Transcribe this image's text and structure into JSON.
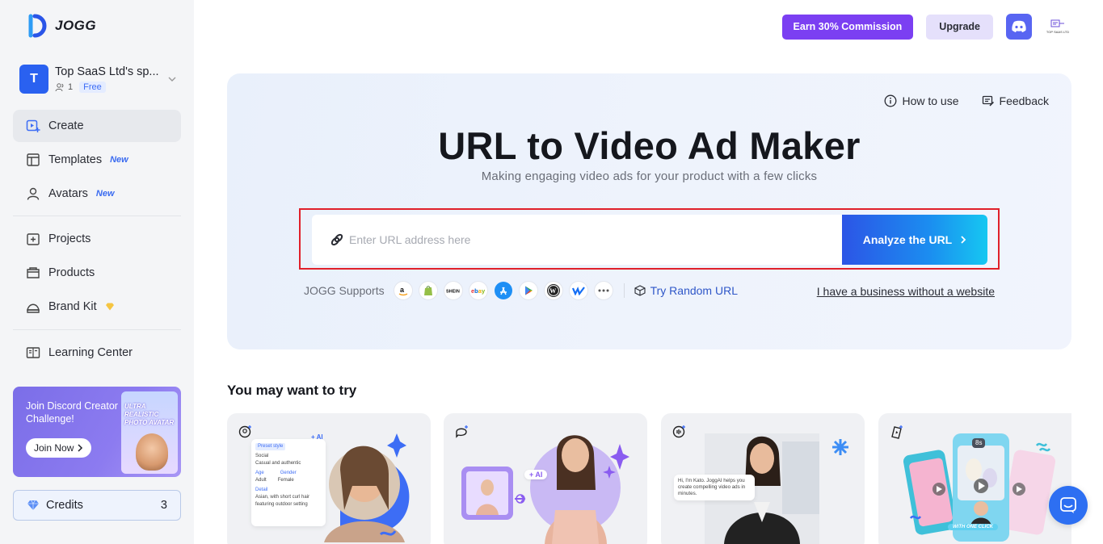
{
  "brand": {
    "name": "JOGG"
  },
  "workspace": {
    "initial": "T",
    "name": "Top SaaS Ltd's sp...",
    "members": "1",
    "plan": "Free"
  },
  "nav": {
    "create": "Create",
    "templates": "Templates",
    "templates_badge": "New",
    "avatars": "Avatars",
    "avatars_badge": "New",
    "projects": "Projects",
    "products": "Products",
    "brand_kit": "Brand Kit",
    "learning_center": "Learning Center"
  },
  "promo": {
    "title": "Join Discord Creator Challenge!",
    "button": "Join Now",
    "card_label": "ULTRA REALISTIC PHOTO AVATAR"
  },
  "credits": {
    "label": "Credits",
    "value": "3"
  },
  "topbar": {
    "earn": "Earn 30% Commission",
    "upgrade": "Upgrade",
    "user_logo_text": "TOP SAAS LTD"
  },
  "hero": {
    "how_to_use": "How to use",
    "feedback": "Feedback",
    "title": "URL to Video Ad Maker",
    "subtitle": "Making engaging video ads for your product with a few clicks",
    "url_placeholder": "Enter URL address here",
    "analyze_button": "Analyze the URL",
    "supports_label": "JOGG Supports",
    "platforms": [
      "amazon-icon",
      "shopify-icon",
      "shein-icon",
      "ebay-icon",
      "app-store-icon",
      "google-play-icon",
      "wordpress-icon",
      "webflow-icon",
      "more-icon"
    ],
    "try_random": "Try Random URL",
    "no_website": "I have a business without a website"
  },
  "try_section": {
    "title": "You may want to try",
    "card1": {
      "preset_style": "Preset style",
      "social": "Social",
      "casual": "Casual and authentic",
      "age": "Age",
      "gender": "Gender",
      "adult": "Adult",
      "female": "Female",
      "detail": "Detail",
      "detail_text": "Asian, with short curl hair featuring outdoor setting",
      "ai_tag": "+ AI"
    },
    "card2": {
      "ai_tag": "+ AI"
    },
    "card3": {
      "speech": "Hi, I'm Kato. JoggAI helps you create compelling video ads in minutes."
    },
    "card4": {
      "duration": "8s",
      "cta": "WITH ONE CLICK"
    }
  },
  "colors": {
    "accent": "#2a61f0",
    "earn": "#7b3ff2",
    "discord": "#5865f2",
    "frame": "#e0202a"
  }
}
